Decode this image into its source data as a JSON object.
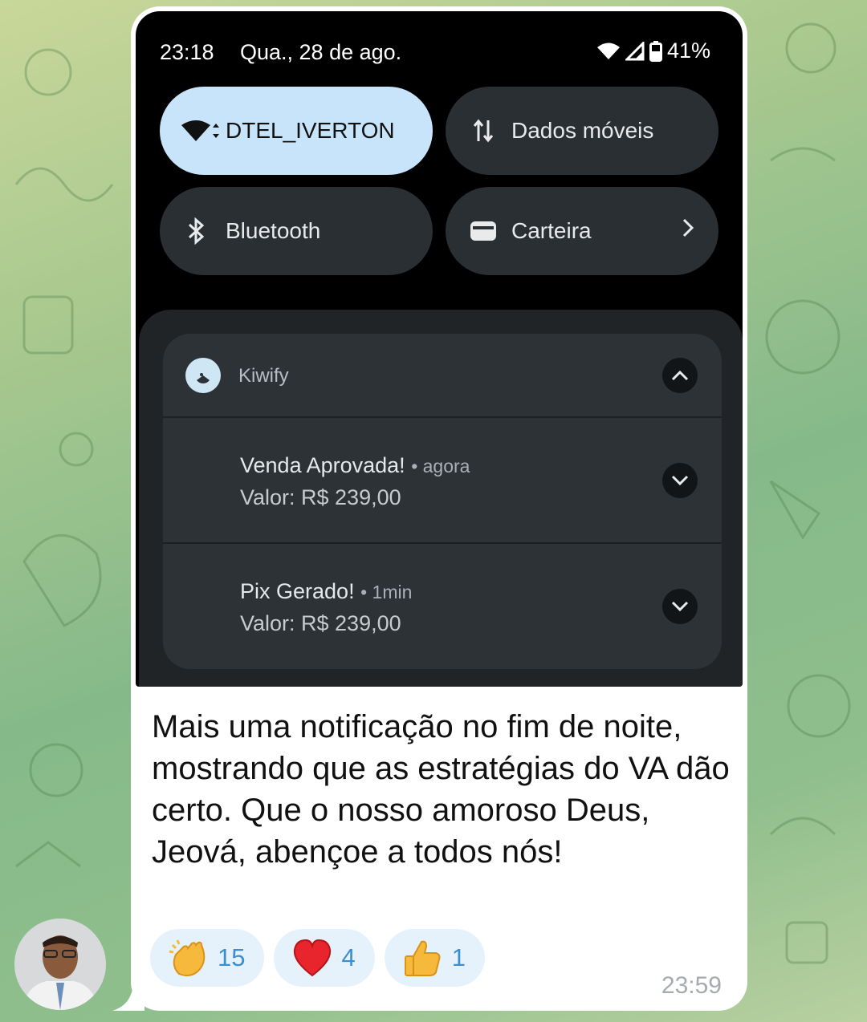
{
  "status_bar": {
    "time": "23:18",
    "date": "Qua., 28 de ago.",
    "battery": "41%"
  },
  "quick_settings": {
    "wifi": {
      "label": "DTEL_IVERTON",
      "icon": "wifi-icon",
      "active": true
    },
    "mobile_data": {
      "label": "Dados móveis",
      "icon": "mobile-data-icon",
      "active": false
    },
    "bluetooth": {
      "label": "Bluetooth",
      "icon": "bluetooth-icon",
      "active": false
    },
    "wallet": {
      "label": "Carteira",
      "icon": "wallet-icon",
      "active": false
    }
  },
  "notification_group": {
    "app_name": "Kiwify",
    "items": [
      {
        "title": "Venda Aprovada!",
        "time": "• agora",
        "body": "Valor: R$ 239,00"
      },
      {
        "title": "Pix Gerado!",
        "time": "• 1min",
        "body": "Valor: R$ 239,00"
      }
    ]
  },
  "message": {
    "text": "Mais uma notificação no fim de noite, mostrando que as estratégias do VA dão certo. Que o nosso amoroso Deus, Jeová, abençoe a todos nós!",
    "time": "23:59",
    "reactions": [
      {
        "emoji": "clapping-hands-emoji",
        "count": "15"
      },
      {
        "emoji": "red-heart-emoji",
        "count": "4"
      },
      {
        "emoji": "thumbs-up-emoji",
        "count": "1"
      }
    ]
  },
  "colors": {
    "active_tile": "#c8e4fb",
    "tile": "#2a2f33",
    "reaction_bg": "#e6f2fb",
    "reaction_count": "#3c8fcf"
  }
}
